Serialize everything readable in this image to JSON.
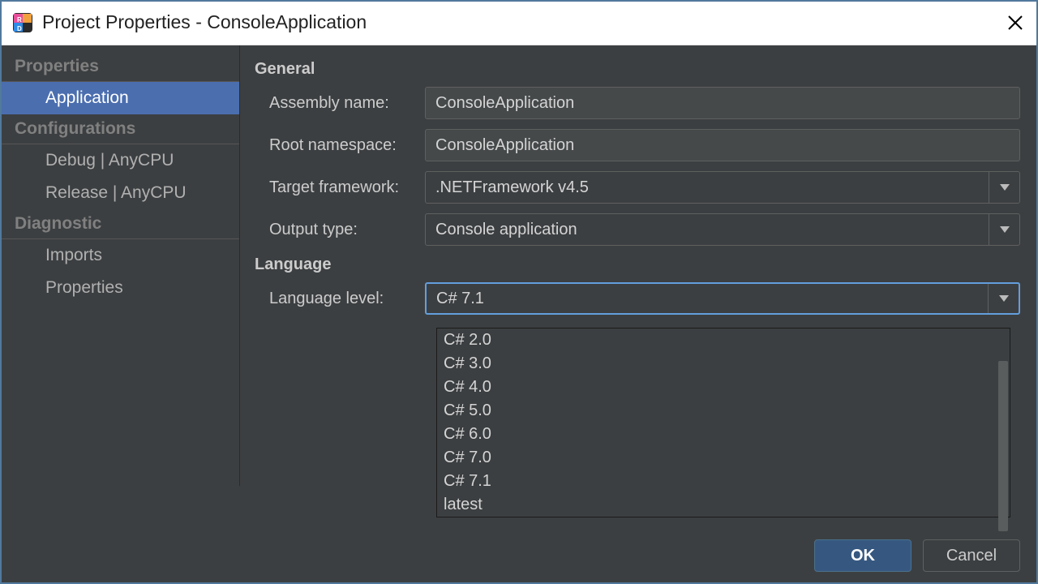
{
  "titlebar": {
    "title": "Project Properties - ConsoleApplication"
  },
  "sidebar": {
    "groups": [
      {
        "label": "Properties",
        "items": [
          {
            "label": "Application",
            "selected": true
          }
        ]
      },
      {
        "label": "Configurations",
        "items": [
          {
            "label": "Debug | AnyCPU",
            "selected": false
          },
          {
            "label": "Release | AnyCPU",
            "selected": false
          }
        ]
      },
      {
        "label": "Diagnostic",
        "items": [
          {
            "label": "Imports",
            "selected": false
          },
          {
            "label": "Properties",
            "selected": false
          }
        ]
      }
    ]
  },
  "main": {
    "general": {
      "header": "General",
      "assembly_name_label": "Assembly name:",
      "assembly_name_value": "ConsoleApplication",
      "root_namespace_label": "Root namespace:",
      "root_namespace_value": "ConsoleApplication",
      "target_framework_label": "Target framework:",
      "target_framework_value": ".NETFramework v4.5",
      "output_type_label": "Output type:",
      "output_type_value": "Console application"
    },
    "language": {
      "header": "Language",
      "language_level_label": "Language level:",
      "language_level_value": "C# 7.1",
      "options": [
        "C# 2.0",
        "C# 3.0",
        "C# 4.0",
        "C# 5.0",
        "C# 6.0",
        "C# 7.0",
        "C# 7.1",
        "latest"
      ]
    }
  },
  "footer": {
    "ok_label": "OK",
    "cancel_label": "Cancel"
  }
}
